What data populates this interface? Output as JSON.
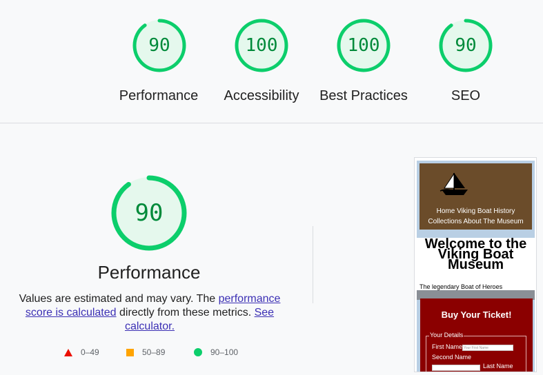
{
  "categories": [
    {
      "name": "performance",
      "label": "Performance",
      "score": "90",
      "value": 90
    },
    {
      "name": "accessibility",
      "label": "Accessibility",
      "score": "100",
      "value": 100
    },
    {
      "name": "best-practices",
      "label": "Best Practices",
      "score": "100",
      "value": 100
    },
    {
      "name": "seo",
      "label": "SEO",
      "score": "90",
      "value": 90
    }
  ],
  "main": {
    "score": "90",
    "value": 90,
    "title": "Performance",
    "desc_prefix": "Values are estimated and may vary. The ",
    "desc_link1": "performance score is calculated",
    "desc_mid": " directly from these metrics. ",
    "desc_link2": "See calculator."
  },
  "legend": [
    {
      "icon": "triangle-icon",
      "range": "0–49",
      "color": "#eb0f00"
    },
    {
      "icon": "square-icon",
      "range": "50–89",
      "color": "#ffa400"
    },
    {
      "icon": "circle-icon",
      "range": "90–100",
      "color": "#0cce6b"
    }
  ],
  "colors": {
    "pass": "#0cce6b",
    "pass_text": "#008a3a",
    "pass_bg": "#e5f8ed"
  },
  "screenshot": {
    "nav_line1": "Home  Viking Boat History",
    "nav_line2": "Collections  About The Museum",
    "heading": "Welcome to the Viking Boat Museum",
    "tagline": "The legendary Boat of Heroes",
    "ticket_title": "Buy Your Ticket!",
    "fieldset_legend": "Your Details",
    "first_name_label": "First Name",
    "first_name_placeholder": "Your First Name",
    "second_name_label": "Second Name",
    "last_name_label": "Last Name"
  }
}
